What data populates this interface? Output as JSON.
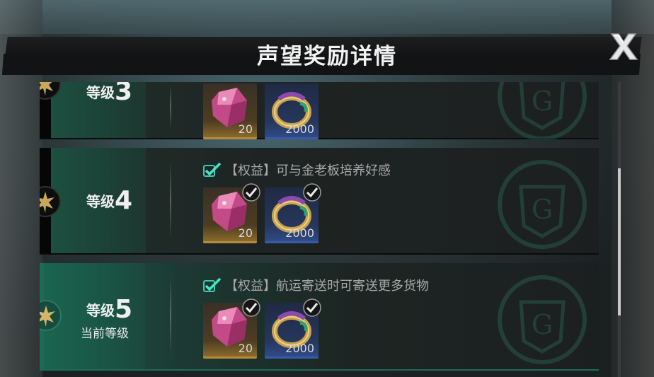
{
  "title": "声望奖励详情",
  "close_icon": "close-x-icon",
  "levels": [
    {
      "word": "等级",
      "number": "3",
      "perk": "",
      "items": [
        {
          "icon": "pink-crystal-icon",
          "qty": "20",
          "owned": true
        },
        {
          "icon": "gold-ring-icon",
          "qty": "2000",
          "owned": true
        }
      ]
    },
    {
      "word": "等级",
      "number": "4",
      "perk": "【权益】可与金老板培养好感",
      "items": [
        {
          "icon": "pink-crystal-icon",
          "qty": "20",
          "owned": true
        },
        {
          "icon": "gold-ring-icon",
          "qty": "2000",
          "owned": true
        }
      ]
    },
    {
      "word": "等级",
      "number": "5",
      "current_label": "当前等级",
      "perk": "【权益】航运寄送时可寄送更多货物",
      "items": [
        {
          "icon": "pink-crystal-icon",
          "qty": "20",
          "owned": true
        },
        {
          "icon": "gold-ring-icon",
          "qty": "2000",
          "owned": true
        }
      ]
    }
  ],
  "colors": {
    "accent_green": "#1e6a56",
    "check_cyan": "#41e0c0",
    "gold_star": "#c9a85a"
  }
}
